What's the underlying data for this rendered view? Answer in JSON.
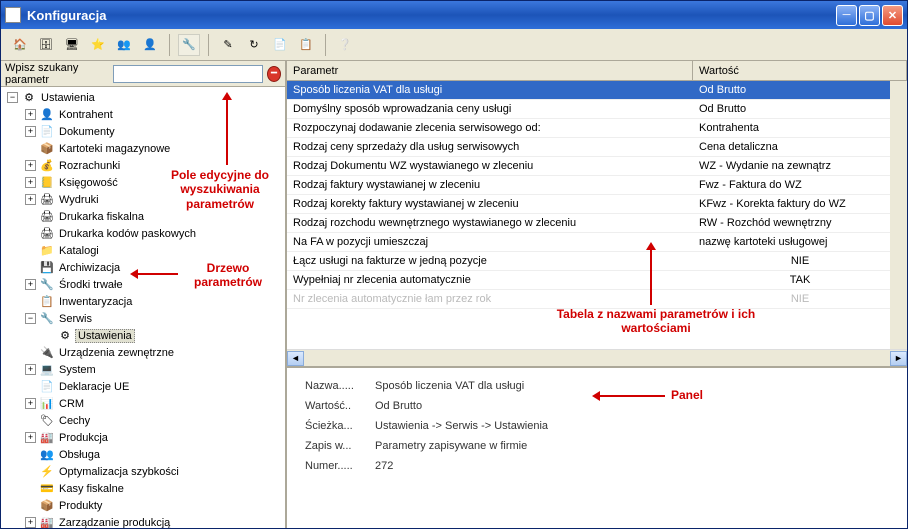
{
  "window": {
    "title": "Konfiguracja"
  },
  "search": {
    "label": "Wpisz szukany parametr",
    "value": ""
  },
  "tree": [
    {
      "lvl": 1,
      "exp": "-",
      "icon": "⚙",
      "label": "Ustawienia"
    },
    {
      "lvl": 2,
      "exp": "+",
      "icon": "👤",
      "label": "Kontrahent"
    },
    {
      "lvl": 2,
      "exp": "+",
      "icon": "📄",
      "label": "Dokumenty"
    },
    {
      "lvl": 2,
      "exp": "",
      "icon": "📦",
      "label": "Kartoteki magazynowe"
    },
    {
      "lvl": 2,
      "exp": "+",
      "icon": "💰",
      "label": "Rozrachunki"
    },
    {
      "lvl": 2,
      "exp": "+",
      "icon": "📒",
      "label": "Księgowość"
    },
    {
      "lvl": 2,
      "exp": "+",
      "icon": "🖨",
      "label": "Wydruki"
    },
    {
      "lvl": 2,
      "exp": "",
      "icon": "🖨",
      "label": "Drukarka fiskalna"
    },
    {
      "lvl": 2,
      "exp": "",
      "icon": "🖨",
      "label": "Drukarka kodów paskowych"
    },
    {
      "lvl": 2,
      "exp": "",
      "icon": "📁",
      "label": "Katalogi"
    },
    {
      "lvl": 2,
      "exp": "",
      "icon": "💾",
      "label": "Archiwizacja"
    },
    {
      "lvl": 2,
      "exp": "+",
      "icon": "🔧",
      "label": "Środki trwałe"
    },
    {
      "lvl": 2,
      "exp": "",
      "icon": "📋",
      "label": "Inwentaryzacja"
    },
    {
      "lvl": 2,
      "exp": "-",
      "icon": "🔧",
      "label": "Serwis"
    },
    {
      "lvl": 3,
      "exp": "",
      "icon": "⚙",
      "label": "Ustawienia",
      "sel": true
    },
    {
      "lvl": 2,
      "exp": "",
      "icon": "🔌",
      "label": "Urządzenia zewnętrzne"
    },
    {
      "lvl": 2,
      "exp": "+",
      "icon": "💻",
      "label": "System"
    },
    {
      "lvl": 2,
      "exp": "",
      "icon": "📄",
      "label": "Deklaracje UE"
    },
    {
      "lvl": 2,
      "exp": "+",
      "icon": "📊",
      "label": "CRM"
    },
    {
      "lvl": 2,
      "exp": "",
      "icon": "🏷",
      "label": "Cechy"
    },
    {
      "lvl": 2,
      "exp": "+",
      "icon": "🏭",
      "label": "Produkcja"
    },
    {
      "lvl": 2,
      "exp": "",
      "icon": "👥",
      "label": "Obsługa"
    },
    {
      "lvl": 2,
      "exp": "",
      "icon": "⚡",
      "label": "Optymalizacja szybkości"
    },
    {
      "lvl": 2,
      "exp": "",
      "icon": "💳",
      "label": "Kasy fiskalne"
    },
    {
      "lvl": 2,
      "exp": "",
      "icon": "📦",
      "label": "Produkty"
    },
    {
      "lvl": 2,
      "exp": "+",
      "icon": "🏭",
      "label": "Zarządzanie produkcją"
    }
  ],
  "grid": {
    "col_param": "Parametr",
    "col_value": "Wartość",
    "rows": [
      {
        "p": "Sposób liczenia VAT dla usługi",
        "v": "Od Brutto",
        "sel": true
      },
      {
        "p": "Domyślny sposób wprowadzania ceny usługi",
        "v": "Od Brutto"
      },
      {
        "p": "Rozpoczynaj dodawanie zlecenia serwisowego od:",
        "v": "Kontrahenta"
      },
      {
        "p": "Rodzaj ceny sprzedaży dla usług serwisowych",
        "v": "Cena detaliczna"
      },
      {
        "p": "Rodzaj Dokumentu WZ wystawianego w zleceniu",
        "v": "WZ - Wydanie na zewnątrz"
      },
      {
        "p": "Rodzaj faktury wystawianej w zleceniu",
        "v": "Fwz - Faktura do WZ"
      },
      {
        "p": "Rodzaj korekty faktury wystawianej w zleceniu",
        "v": "KFwz - Korekta faktury do WZ"
      },
      {
        "p": "Rodzaj rozchodu wewnętrznego wystawianego w zleceniu",
        "v": "RW - Rozchód wewnętrzny"
      },
      {
        "p": "Na FA w pozycji umieszczaj",
        "v": "nazwę kartoteki usługowej"
      },
      {
        "p": "Łącz usługi na fakturze w jedną pozycje",
        "v": "NIE",
        "c": true
      },
      {
        "p": "Wypełniaj nr zlecenia automatycznie",
        "v": "TAK",
        "c": true
      },
      {
        "p": "Nr zlecenia automatycznie łam przez rok",
        "v": "NIE",
        "dis": true,
        "c": true
      }
    ]
  },
  "detail": {
    "nazwa_lab": "Nazwa.....",
    "nazwa": "Sposób liczenia VAT dla usługi",
    "wartosc_lab": "Wartość..",
    "wartosc": "Od Brutto",
    "sciezka_lab": "Ścieżka...",
    "sciezka": "Ustawienia -> Serwis -> Ustawienia",
    "zapis_lab": "Zapis w...",
    "zapis": "Parametry zapisywane w firmie",
    "numer_lab": "Numer.....",
    "numer": "272"
  },
  "annotations": {
    "search": "Pole edycyjne do wyszukiwania parametrów",
    "tree": "Drzewo parametrów",
    "table": "Tabela z nazwami parametrów i ich wartościami",
    "panel": "Panel"
  }
}
